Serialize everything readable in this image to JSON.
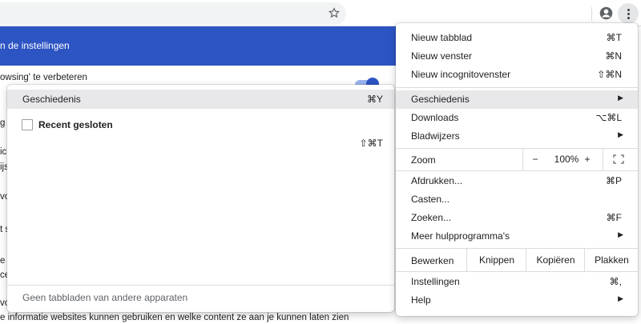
{
  "toolbar": {
    "bookmark_icon": "star-outline-icon",
    "profile_icon": "account-circle-icon",
    "menu_icon": "vertical-dots-icon"
  },
  "settings": {
    "search_text": "n de instellingen",
    "lines": [
      "owsing' te verbeteren",
      "g",
      "ic",
      "ijs",
      "vo",
      "t s",
      "e",
      "ce",
      "vo",
      "e informatie websites kunnen gebruiken en welke content ze aan je kunnen laten zien"
    ],
    "header_color": "#2d54c3"
  },
  "submenu": {
    "title": "Geschiedenis",
    "title_shortcut": "⌘Y",
    "recent_label": "Recent gesloten",
    "recent_shortcut": "⇧⌘T",
    "footer": "Geen tabbladen van andere apparaten"
  },
  "menu": {
    "new_tab": {
      "label": "Nieuw tabblad",
      "shortcut": "⌘T"
    },
    "new_window": {
      "label": "Nieuw venster",
      "shortcut": "⌘N"
    },
    "new_incognito": {
      "label": "Nieuw incognitovenster",
      "shortcut": "⇧⌘N"
    },
    "history": {
      "label": "Geschiedenis",
      "arrow": "▶"
    },
    "downloads": {
      "label": "Downloads",
      "shortcut": "⌥⌘L"
    },
    "bookmarks": {
      "label": "Bladwijzers",
      "arrow": "▶"
    },
    "zoom": {
      "label": "Zoom",
      "minus": "−",
      "value": "100%",
      "plus": "+"
    },
    "print": {
      "label": "Afdrukken...",
      "shortcut": "⌘P"
    },
    "cast": {
      "label": "Casten..."
    },
    "find": {
      "label": "Zoeken...",
      "shortcut": "⌘F"
    },
    "more_tools": {
      "label": "Meer hulpprogramma's",
      "arrow": "▶"
    },
    "edit": {
      "label": "Bewerken",
      "cut": "Knippen",
      "copy": "Kopiëren",
      "paste": "Plakken"
    },
    "settings": {
      "label": "Instellingen",
      "shortcut": "⌘,"
    },
    "help": {
      "label": "Help",
      "arrow": "▶"
    }
  }
}
